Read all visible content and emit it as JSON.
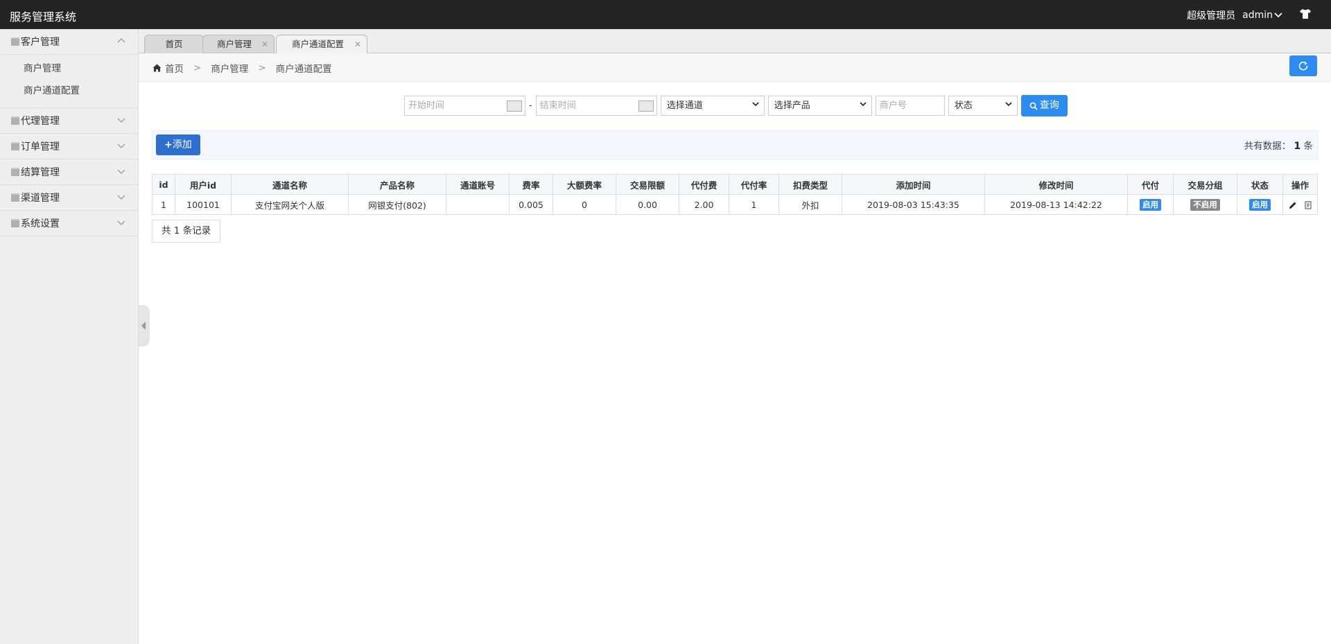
{
  "header": {
    "title": "服务管理系统",
    "role": "超级管理员",
    "username": "admin"
  },
  "sidebar": {
    "menus": [
      {
        "label": "客户管理",
        "expanded": true,
        "items": [
          "商户管理",
          "商户通道配置"
        ]
      },
      {
        "label": "代理管理",
        "expanded": false
      },
      {
        "label": "订单管理",
        "expanded": false
      },
      {
        "label": "结算管理",
        "expanded": false
      },
      {
        "label": "渠道管理",
        "expanded": false
      },
      {
        "label": "系统设置",
        "expanded": false
      }
    ]
  },
  "tabs": [
    {
      "label": "首页"
    },
    {
      "label": "商户管理"
    },
    {
      "label": "商户通道配置",
      "active": true
    }
  ],
  "breadcrumb": {
    "home": "首页",
    "level1": "商户管理",
    "level2": "商户通道配置",
    "separator": ">"
  },
  "filters": {
    "start_placeholder": "开始时间",
    "dash": "-",
    "end_placeholder": "结束时间",
    "channel": "选择通道",
    "product": "选择产品",
    "merchant_placeholder": "商户号",
    "status": "状态",
    "query_label": "查询"
  },
  "toolbar": {
    "add_label": "添加",
    "total_prefix": "共有数据：",
    "total_count": "1",
    "total_suffix": "条"
  },
  "table": {
    "headers": [
      "id",
      "用户id",
      "通道名称",
      "产品名称",
      "通道账号",
      "费率",
      "大额费率",
      "交易限额",
      "代付费",
      "代付率",
      "扣费类型",
      "添加时间",
      "修改时间",
      "代付",
      "交易分组",
      "状态",
      "操作"
    ],
    "rows": [
      {
        "id": "1",
        "user_id": "100101",
        "channel": "支付宝网关个人版",
        "product": "网银支付(802)",
        "account": "",
        "rate": "0.005",
        "big_rate": "0",
        "limit": "0.00",
        "payout_fee": "2.00",
        "payout_rate": "1",
        "deduct_type": "外扣",
        "created": "2019-08-03 15:43:35",
        "modified": "2019-08-13 14:42:22",
        "payout": "启用",
        "group": "不启用",
        "status": "启用"
      }
    ]
  },
  "pager": {
    "text": "共 1 条记录"
  },
  "colors": {
    "primary": "#2d8cf0",
    "topbar": "#242424",
    "label_off": "#888888"
  }
}
